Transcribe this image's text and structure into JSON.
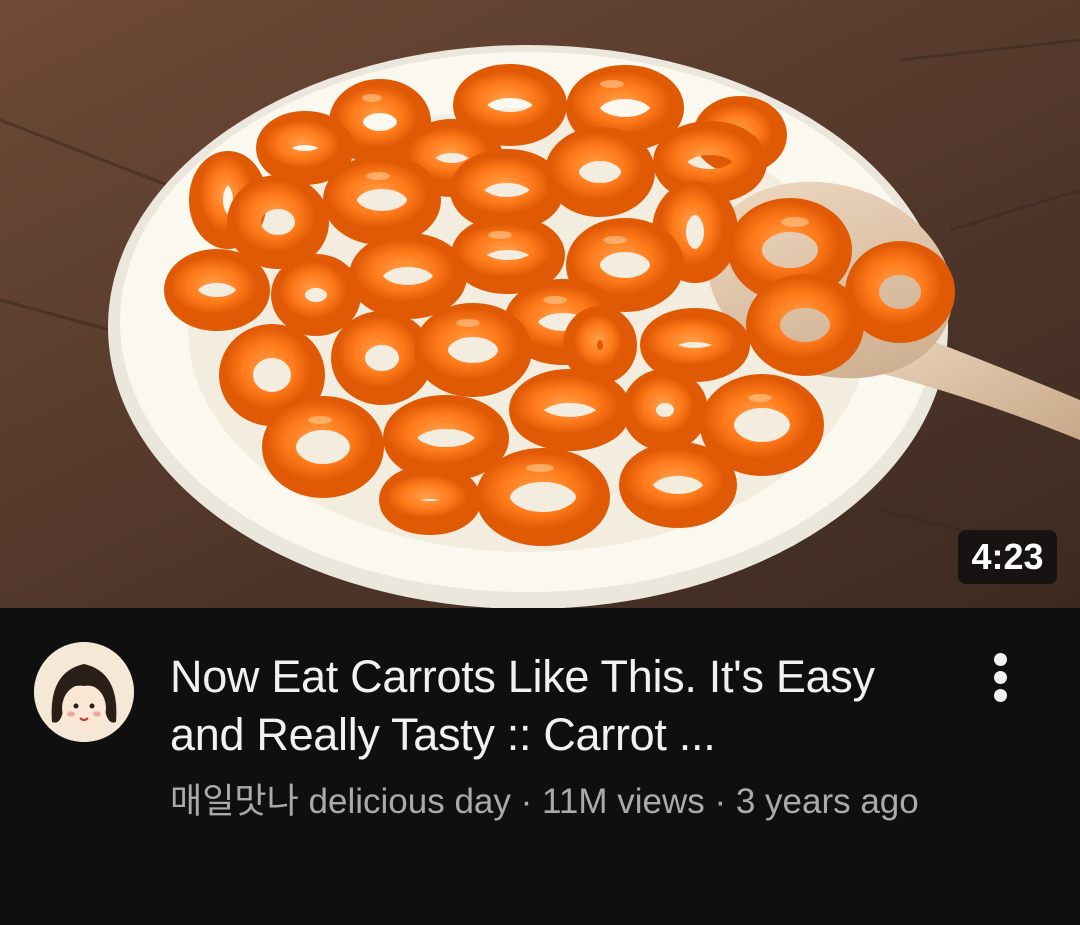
{
  "video": {
    "duration": "4:23",
    "title": "Now Eat Carrots Like This. It's Easy and Really Tasty :: Carrot ...",
    "channel": "매일맛나 delicious day",
    "separator": " · ",
    "views": "11M views",
    "age": "3 years ago"
  },
  "icons": {
    "menu": "more-vert-icon",
    "avatar": "channel-avatar-girl"
  },
  "colors": {
    "background": "#0f0f0f",
    "title": "#f1f1f1",
    "secondary": "#aaaaaa",
    "duration_badge": "#0f0f0f"
  }
}
